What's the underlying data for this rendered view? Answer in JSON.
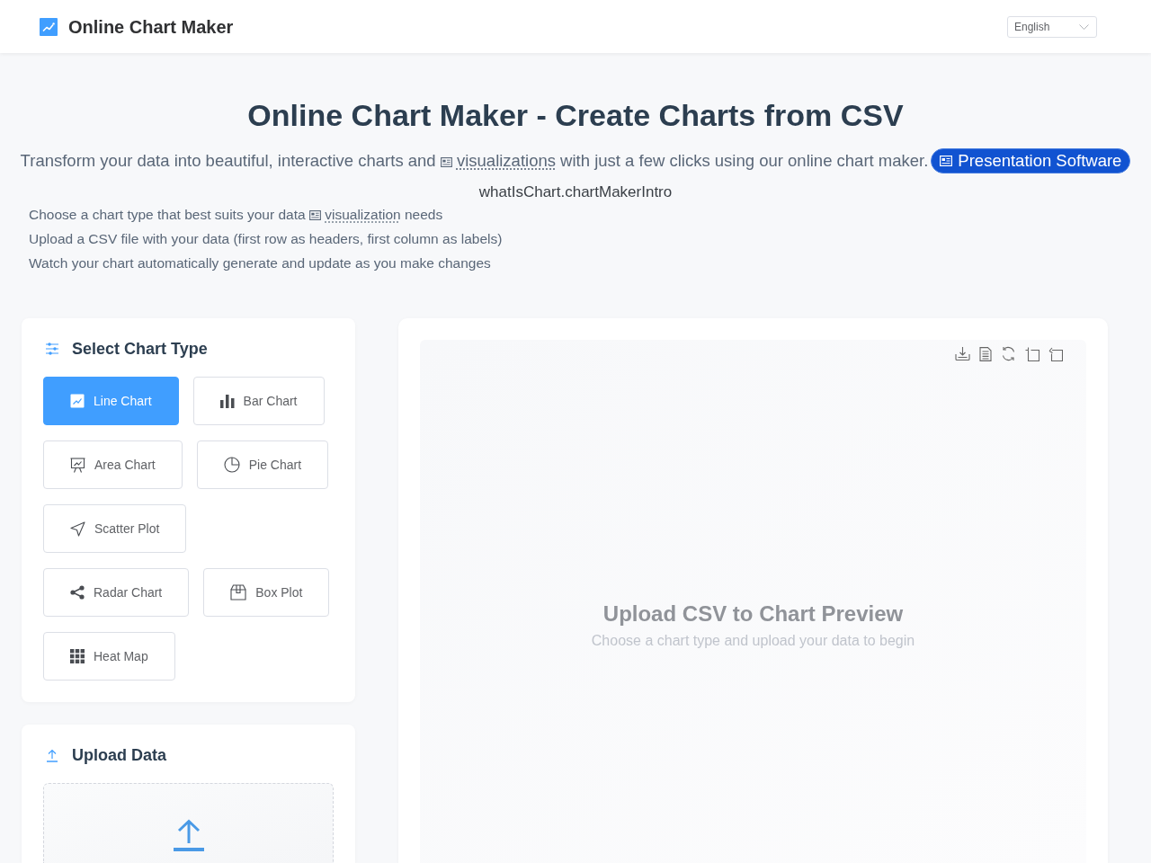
{
  "header": {
    "title": "Online Chart Maker",
    "language": {
      "value": "English"
    }
  },
  "hero": {
    "title": "Online Chart Maker - Create Charts from CSV",
    "subtitle": {
      "before": "Transform your data into beautiful, interactive charts and",
      "link": "visualizations",
      "after": "with just a few clicks using our online chart maker."
    },
    "badge": "Presentation Software",
    "intro": "whatIsChart.chartMakerIntro",
    "steps": [
      {
        "before": "Choose a chart type that best suits your data",
        "link": "visualization",
        "after": "needs"
      },
      {
        "text": "Upload a CSV file with your data (first row as headers, first column as labels)"
      },
      {
        "text": "Watch your chart automatically generate and update as you make changes"
      }
    ]
  },
  "chart_type_panel": {
    "title": "Select Chart Type",
    "options": [
      {
        "label": "Line Chart",
        "selected": true
      },
      {
        "label": "Bar Chart",
        "selected": false
      },
      {
        "label": "Area Chart",
        "selected": false
      },
      {
        "label": "Pie Chart",
        "selected": false
      },
      {
        "label": "Scatter Plot",
        "selected": false
      },
      {
        "label": "Radar Chart",
        "selected": false
      },
      {
        "label": "Box Plot",
        "selected": false
      },
      {
        "label": "Heat Map",
        "selected": false
      }
    ]
  },
  "upload_panel": {
    "title": "Upload Data"
  },
  "preview": {
    "title": "Upload CSV to Chart Preview",
    "hint": "Choose a chart type and upload your data to begin"
  }
}
